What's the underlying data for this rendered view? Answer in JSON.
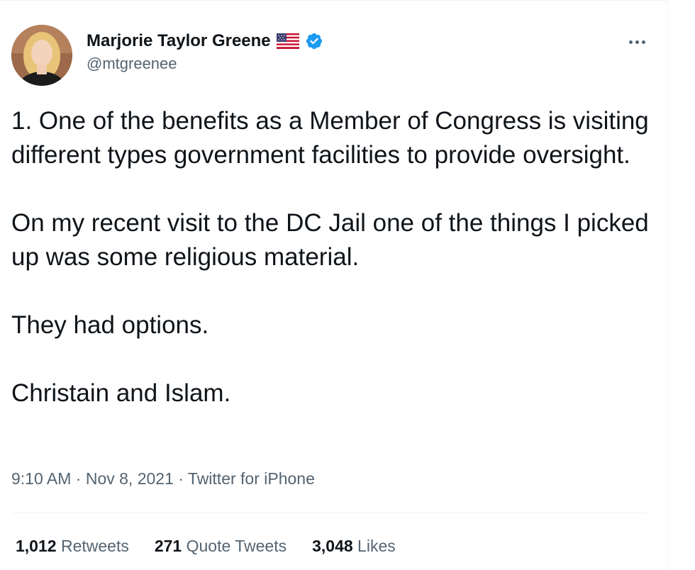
{
  "tweet": {
    "author": {
      "display_name": "Marjorie Taylor Greene",
      "handle": "@mtgreenee",
      "flag_icon": "us-flag-icon",
      "verified_icon": "verified-badge-icon"
    },
    "text": {
      "p1": "1. One of the benefits as a Member of Congress is visiting different types government facilities to provide oversight.",
      "p2": "On my recent visit to the DC Jail one of the things I picked up was some religious material.",
      "p3": "They had options.",
      "p4": "Christain and Islam."
    },
    "meta": {
      "time": "9:10 AM",
      "sep": "·",
      "date": "Nov 8, 2021",
      "source": "Twitter for iPhone"
    },
    "stats": {
      "retweets_count": "1,012",
      "retweets_label": "Retweets",
      "quote_count": "271",
      "quote_label": "Quote Tweets",
      "likes_count": "3,048",
      "likes_label": "Likes"
    }
  },
  "colors": {
    "text": "#0f1419",
    "secondary": "#536471",
    "verified": "#1d9bf0",
    "divider": "#eff3f4"
  }
}
